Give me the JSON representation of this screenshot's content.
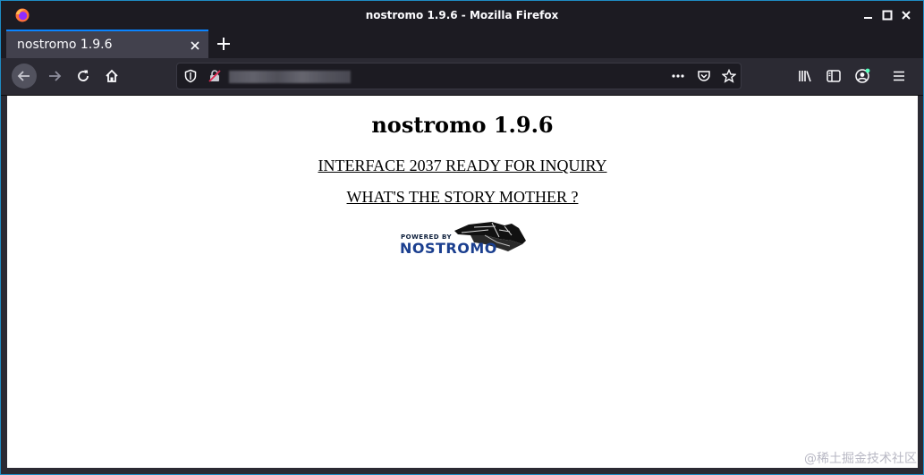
{
  "window": {
    "title": "nostromo 1.9.6 - Mozilla Firefox"
  },
  "tabs": [
    {
      "label": "nostromo 1.9.6"
    }
  ],
  "urlbar": {
    "value": "",
    "placeholder": ""
  },
  "page": {
    "heading": "nostromo 1.9.6",
    "link1": "INTERFACE 2037 READY FOR INQUIRY",
    "link2": "WHAT'S THE STORY MOTHER ?",
    "logo": {
      "powered_by": "POWERED BY",
      "brand": "NOSTROMO"
    }
  },
  "watermark": "@稀土掘金技术社区",
  "icons": {
    "titlebar": [
      "firefox-logo-icon",
      "minimize-icon",
      "maximize-icon",
      "close-icon"
    ],
    "tab": [
      "tab-close-icon",
      "new-tab-icon"
    ],
    "nav": [
      "back-arrow-icon",
      "forward-arrow-icon",
      "reload-icon",
      "home-icon"
    ],
    "url": [
      "tracking-shield-icon",
      "insecure-lock-icon",
      "page-actions-icon",
      "pocket-icon",
      "bookmark-star-icon"
    ],
    "toolbar_right": [
      "library-icon",
      "sidebar-icon",
      "account-icon",
      "menu-icon"
    ]
  },
  "colors": {
    "accent": "#0a84ff",
    "frame": "#1c1b22",
    "toolbar": "#2b2a33",
    "tab_active": "#42414d",
    "logo_brand": "#1b3f8f"
  }
}
